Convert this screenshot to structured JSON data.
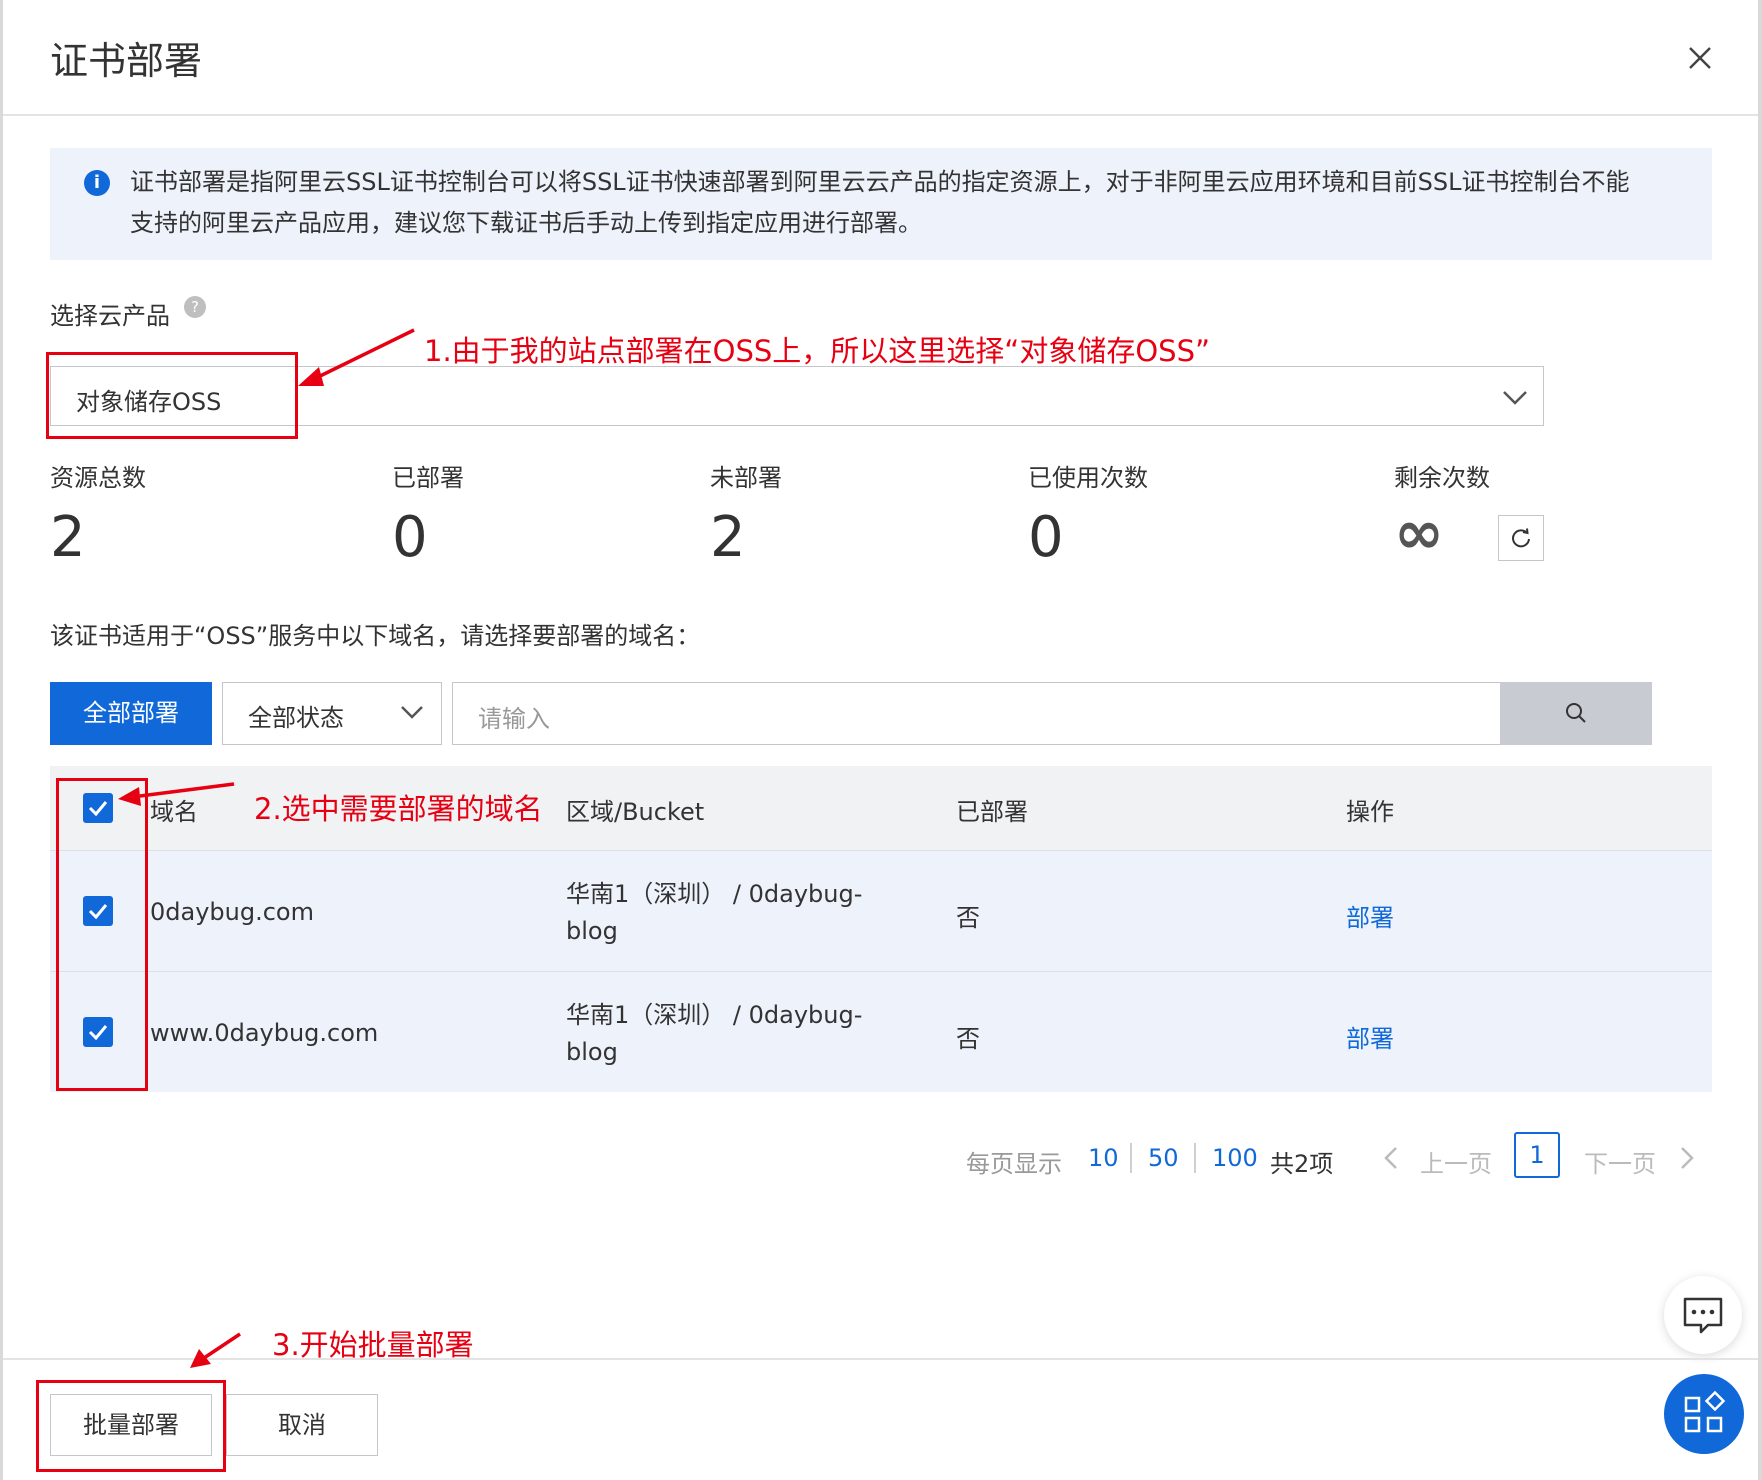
{
  "dialog": {
    "title": "证书部署",
    "notice": "证书部署是指阿里云SSL证书控制台可以将SSL证书快速部署到阿里云云产品的指定资源上，对于非阿里云应用环境和目前SSL证书控制台不能支持的阿里云产品应用，建议您下载证书后手动上传到指定应用进行部署。",
    "select_label": "选择云产品",
    "select_value": "对象储存OSS",
    "stats": [
      {
        "label": "资源总数",
        "value": "2"
      },
      {
        "label": "已部署",
        "value": "0"
      },
      {
        "label": "未部署",
        "value": "2"
      },
      {
        "label": "已使用次数",
        "value": "0"
      },
      {
        "label": "剩余次数",
        "value": "∞"
      }
    ],
    "domain_desc": "该证书适用于“OSS”服务中以下域名，请选择要部署的域名：",
    "deploy_all_label": "全部部署",
    "status_select_value": "全部状态",
    "search_placeholder": "请输入"
  },
  "table": {
    "headers": {
      "domain": "域名",
      "region": "区域/Bucket",
      "deployed": "已部署",
      "action": "操作"
    },
    "rows": [
      {
        "domain": "0daybug.com",
        "region_line1": "华南1（深圳） / 0daybug-",
        "region_line2": "blog",
        "deployed": "否",
        "action": "部署",
        "checked": true
      },
      {
        "domain": "www.0daybug.com",
        "region_line1": "华南1（深圳） / 0daybug-",
        "region_line2": "blog",
        "deployed": "否",
        "action": "部署",
        "checked": true
      }
    ]
  },
  "pagination": {
    "per_page_label": "每页显示",
    "sizes": [
      "10",
      "50",
      "100"
    ],
    "total": "共2项",
    "prev": "上一页",
    "current": "1",
    "next": "下一页"
  },
  "footer": {
    "batch_label": "批量部署",
    "cancel_label": "取消"
  },
  "annotations": {
    "a1": "1.由于我的站点部署在OSS上，所以这里选择“对象储存OSS”",
    "a2": "2.选中需要部署的域名",
    "a3": "3.开始批量部署"
  },
  "colors": {
    "primary": "#1068d9",
    "annotation": "#e60012",
    "notice_bg": "#eef3fb"
  }
}
